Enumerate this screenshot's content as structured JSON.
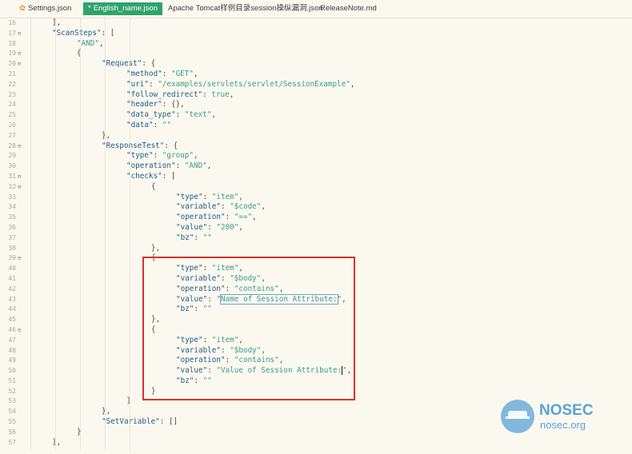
{
  "tabs": [
    {
      "label": "Settings.json",
      "active": false
    },
    {
      "label": "English_name.json",
      "active": true,
      "modified_mark": "*"
    },
    {
      "label": "Apache Tomcat样例目录session操纵漏洞.json",
      "active": false
    },
    {
      "label": "ReleaseNote.md",
      "active": false
    }
  ],
  "editor": {
    "lines": [
      {
        "n": "16",
        "fold": "",
        "indent": 1,
        "tokens": [
          [
            "p",
            "],"
          ]
        ]
      },
      {
        "n": "17",
        "fold": "⊟",
        "indent": 1,
        "tokens": [
          [
            "k",
            "\"ScanSteps\""
          ],
          [
            "p",
            ": ["
          ]
        ]
      },
      {
        "n": "18",
        "fold": "",
        "indent": 2,
        "tokens": [
          [
            "s",
            "\"AND\""
          ],
          [
            "p",
            ","
          ]
        ]
      },
      {
        "n": "19",
        "fold": "⊟",
        "indent": 2,
        "tokens": [
          [
            "p",
            "{"
          ]
        ]
      },
      {
        "n": "20",
        "fold": "⊟",
        "indent": 3,
        "tokens": [
          [
            "k",
            "\"Request\""
          ],
          [
            "p",
            ": {"
          ]
        ]
      },
      {
        "n": "21",
        "fold": "",
        "indent": 4,
        "tokens": [
          [
            "k",
            "\"method\""
          ],
          [
            "p",
            ": "
          ],
          [
            "s",
            "\"GET\""
          ],
          [
            "p",
            ","
          ]
        ]
      },
      {
        "n": "22",
        "fold": "",
        "indent": 4,
        "tokens": [
          [
            "k",
            "\"uri\""
          ],
          [
            "p",
            ": "
          ],
          [
            "s",
            "\"/examples/servlets/servlet/SessionExample\""
          ],
          [
            "p",
            ","
          ]
        ]
      },
      {
        "n": "23",
        "fold": "",
        "indent": 4,
        "tokens": [
          [
            "k",
            "\"follow_redirect\""
          ],
          [
            "p",
            ": "
          ],
          [
            "b",
            "true"
          ],
          [
            "p",
            ","
          ]
        ]
      },
      {
        "n": "24",
        "fold": "",
        "indent": 4,
        "tokens": [
          [
            "k",
            "\"header\""
          ],
          [
            "p",
            ": {},"
          ]
        ]
      },
      {
        "n": "25",
        "fold": "",
        "indent": 4,
        "tokens": [
          [
            "k",
            "\"data_type\""
          ],
          [
            "p",
            ": "
          ],
          [
            "s",
            "\"text\""
          ],
          [
            "p",
            ","
          ]
        ]
      },
      {
        "n": "26",
        "fold": "",
        "indent": 4,
        "tokens": [
          [
            "k",
            "\"data\""
          ],
          [
            "p",
            ": "
          ],
          [
            "s",
            "\"\""
          ]
        ]
      },
      {
        "n": "27",
        "fold": "",
        "indent": 3,
        "tokens": [
          [
            "p",
            "},"
          ]
        ]
      },
      {
        "n": "28",
        "fold": "⊟",
        "indent": 3,
        "tokens": [
          [
            "k",
            "\"ResponseTest\""
          ],
          [
            "p",
            ": {"
          ]
        ]
      },
      {
        "n": "29",
        "fold": "",
        "indent": 4,
        "tokens": [
          [
            "k",
            "\"type\""
          ],
          [
            "p",
            ": "
          ],
          [
            "s",
            "\"group\""
          ],
          [
            "p",
            ","
          ]
        ]
      },
      {
        "n": "30",
        "fold": "",
        "indent": 4,
        "tokens": [
          [
            "k",
            "\"operation\""
          ],
          [
            "p",
            ": "
          ],
          [
            "s",
            "\"AND\""
          ],
          [
            "p",
            ","
          ]
        ]
      },
      {
        "n": "31",
        "fold": "⊟",
        "indent": 4,
        "tokens": [
          [
            "k",
            "\"checks\""
          ],
          [
            "p",
            ": ["
          ]
        ]
      },
      {
        "n": "32",
        "fold": "⊟",
        "indent": 5,
        "tokens": [
          [
            "p",
            "{"
          ]
        ]
      },
      {
        "n": "33",
        "fold": "",
        "indent": 6,
        "tokens": [
          [
            "k",
            "\"type\""
          ],
          [
            "p",
            ": "
          ],
          [
            "s",
            "\"item\""
          ],
          [
            "p",
            ","
          ]
        ]
      },
      {
        "n": "34",
        "fold": "",
        "indent": 6,
        "tokens": [
          [
            "k",
            "\"variable\""
          ],
          [
            "p",
            ": "
          ],
          [
            "s",
            "\"$code\""
          ],
          [
            "p",
            ","
          ]
        ]
      },
      {
        "n": "35",
        "fold": "",
        "indent": 6,
        "tokens": [
          [
            "k",
            "\"operation\""
          ],
          [
            "p",
            ": "
          ],
          [
            "s",
            "\"==\""
          ],
          [
            "p",
            ","
          ]
        ]
      },
      {
        "n": "36",
        "fold": "",
        "indent": 6,
        "tokens": [
          [
            "k",
            "\"value\""
          ],
          [
            "p",
            ": "
          ],
          [
            "s",
            "\"200\""
          ],
          [
            "p",
            ","
          ]
        ]
      },
      {
        "n": "37",
        "fold": "",
        "indent": 6,
        "tokens": [
          [
            "k",
            "\"bz\""
          ],
          [
            "p",
            ": "
          ],
          [
            "s",
            "\"\""
          ]
        ]
      },
      {
        "n": "38",
        "fold": "",
        "indent": 5,
        "tokens": [
          [
            "p",
            "},"
          ]
        ]
      },
      {
        "n": "39",
        "fold": "⊟",
        "indent": 5,
        "tokens": [
          [
            "p",
            "{"
          ]
        ]
      },
      {
        "n": "40",
        "fold": "",
        "indent": 6,
        "tokens": [
          [
            "k",
            "\"type\""
          ],
          [
            "p",
            ": "
          ],
          [
            "s",
            "\"item\""
          ],
          [
            "p",
            ","
          ]
        ]
      },
      {
        "n": "41",
        "fold": "",
        "indent": 6,
        "tokens": [
          [
            "k",
            "\"variable\""
          ],
          [
            "p",
            ": "
          ],
          [
            "s",
            "\"$body\""
          ],
          [
            "p",
            ","
          ]
        ]
      },
      {
        "n": "42",
        "fold": "",
        "indent": 6,
        "tokens": [
          [
            "k",
            "\"operation\""
          ],
          [
            "p",
            ": "
          ],
          [
            "s",
            "\"contains\""
          ],
          [
            "p",
            ","
          ]
        ]
      },
      {
        "n": "43",
        "fold": "",
        "indent": 6,
        "tokens": [
          [
            "k",
            "\"value\""
          ],
          [
            "p",
            ": "
          ],
          [
            "s",
            "\""
          ],
          [
            "h",
            "Name of Session Attribute:"
          ],
          [
            "s",
            "\""
          ],
          [
            "p",
            ","
          ]
        ]
      },
      {
        "n": "44",
        "fold": "",
        "indent": 6,
        "tokens": [
          [
            "k",
            "\"bz\""
          ],
          [
            "p",
            ": "
          ],
          [
            "s",
            "\"\""
          ]
        ]
      },
      {
        "n": "45",
        "fold": "",
        "indent": 5,
        "tokens": [
          [
            "p",
            "},"
          ]
        ]
      },
      {
        "n": "46",
        "fold": "⊟",
        "indent": 5,
        "tokens": [
          [
            "p",
            "{"
          ]
        ]
      },
      {
        "n": "47",
        "fold": "",
        "indent": 6,
        "tokens": [
          [
            "k",
            "\"type\""
          ],
          [
            "p",
            ": "
          ],
          [
            "s",
            "\"item\""
          ],
          [
            "p",
            ","
          ]
        ]
      },
      {
        "n": "48",
        "fold": "",
        "indent": 6,
        "tokens": [
          [
            "k",
            "\"variable\""
          ],
          [
            "p",
            ": "
          ],
          [
            "s",
            "\"$body\""
          ],
          [
            "p",
            ","
          ]
        ]
      },
      {
        "n": "49",
        "fold": "",
        "indent": 6,
        "tokens": [
          [
            "k",
            "\"operation\""
          ],
          [
            "p",
            ": "
          ],
          [
            "s",
            "\"contains\""
          ],
          [
            "p",
            ","
          ]
        ]
      },
      {
        "n": "50",
        "fold": "",
        "indent": 6,
        "tokens": [
          [
            "k",
            "\"value\""
          ],
          [
            "p",
            ": "
          ],
          [
            "s",
            "\"Value of Session Attribute:"
          ],
          [
            "c",
            ""
          ],
          [
            "s",
            "\""
          ],
          [
            "p",
            ","
          ]
        ]
      },
      {
        "n": "51",
        "fold": "",
        "indent": 6,
        "tokens": [
          [
            "k",
            "\"bz\""
          ],
          [
            "p",
            ": "
          ],
          [
            "s",
            "\"\""
          ]
        ]
      },
      {
        "n": "52",
        "fold": "",
        "indent": 5,
        "tokens": [
          [
            "p",
            "}"
          ]
        ]
      },
      {
        "n": "53",
        "fold": "",
        "indent": 4,
        "tokens": [
          [
            "p",
            "]"
          ]
        ]
      },
      {
        "n": "54",
        "fold": "",
        "indent": 3,
        "tokens": [
          [
            "p",
            "},"
          ]
        ]
      },
      {
        "n": "55",
        "fold": "",
        "indent": 3,
        "tokens": [
          [
            "k",
            "\"SetVariable\""
          ],
          [
            "p",
            ": []"
          ]
        ]
      },
      {
        "n": "56",
        "fold": "",
        "indent": 2,
        "tokens": [
          [
            "p",
            "}"
          ]
        ]
      },
      {
        "n": "57",
        "fold": "",
        "indent": 1,
        "tokens": [
          [
            "p",
            "],"
          ]
        ]
      }
    ]
  },
  "watermark": {
    "name": "NOSEC",
    "url": "nosec.org",
    "icon": "nosec-hat-icon"
  },
  "colors": {
    "key": "#1f5a8a",
    "string": "#3a9d8b",
    "highlight_box": "#e0302a",
    "active_tab": "#2fa36a"
  }
}
